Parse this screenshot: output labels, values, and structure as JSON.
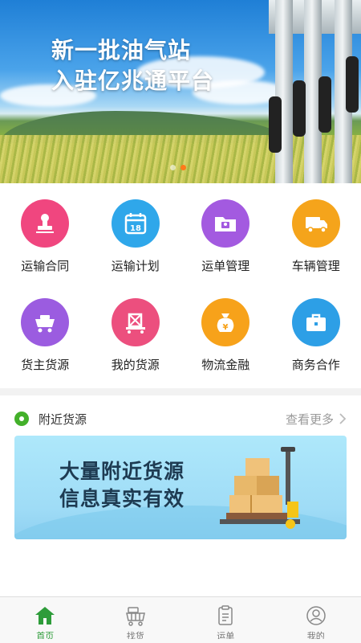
{
  "banner": {
    "title_line1": "新一批油气站",
    "title_line2": "入驻亿兆通平台",
    "dots_total": 2,
    "active_dot": 2,
    "accent_color": "#ff7a1a"
  },
  "grid": {
    "items": [
      {
        "label": "运输合同",
        "icon": "stamp-icon",
        "color": "#f0467f"
      },
      {
        "label": "运输计划",
        "icon": "calendar-icon",
        "color": "#2fa7ea"
      },
      {
        "label": "运单管理",
        "icon": "folder-icon",
        "color": "#a35ae0"
      },
      {
        "label": "车辆管理",
        "icon": "truck-icon",
        "color": "#f5a41b"
      },
      {
        "label": "货主货源",
        "icon": "cart-icon",
        "color": "#9b5ce0"
      },
      {
        "label": "我的货源",
        "icon": "pallet-icon",
        "color": "#ec4f7e"
      },
      {
        "label": "物流金融",
        "icon": "money-bag-icon",
        "color": "#f7a21a"
      },
      {
        "label": "商务合作",
        "icon": "briefcase-icon",
        "color": "#2d9fe6"
      }
    ]
  },
  "nearby": {
    "title": "附近货源",
    "more": "查看更多",
    "promo_line1": "大量附近货源",
    "promo_line2": "信息真实有效"
  },
  "tabbar": {
    "tabs": [
      {
        "label": "首页",
        "icon": "home-icon",
        "active": true
      },
      {
        "label": "找货",
        "icon": "cargo-icon",
        "active": false
      },
      {
        "label": "运单",
        "icon": "clipboard-icon",
        "active": false
      },
      {
        "label": "我的",
        "icon": "user-icon",
        "active": false
      }
    ],
    "active_color": "#2e9c3a"
  }
}
